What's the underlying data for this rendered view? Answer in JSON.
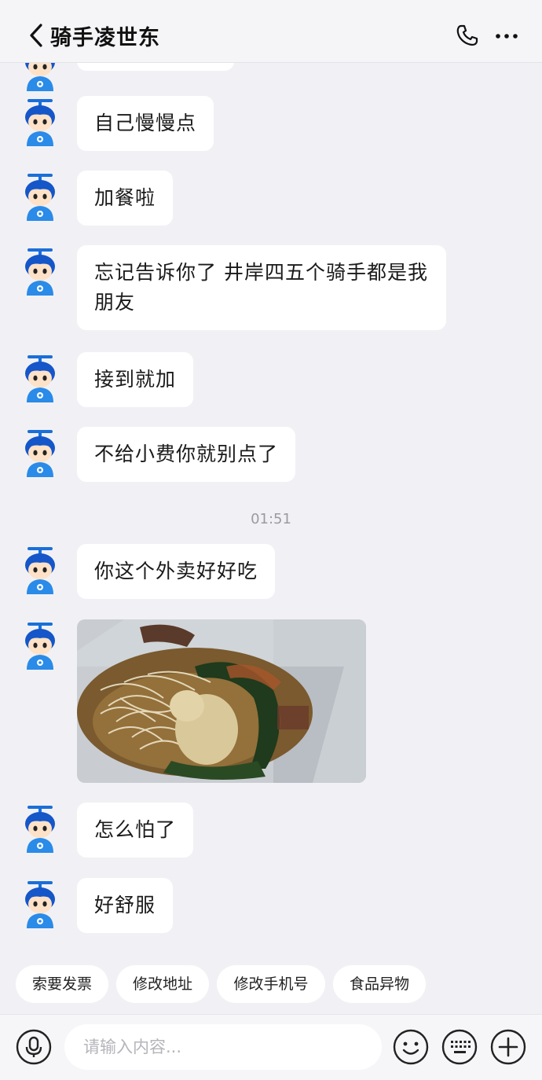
{
  "header": {
    "title": "骑手凌世东",
    "back_icon": "chevron-left-icon",
    "call_icon": "phone-icon",
    "more_icon": "more-dots-icon"
  },
  "messages": [
    {
      "text": "自己慢慢点"
    },
    {
      "text": "加餐啦"
    },
    {
      "text": "忘记告诉你了 井岸四五个骑手都是我",
      "text_line2": "朋友"
    },
    {
      "text": "接到就加"
    },
    {
      "text": "不给小费你就别点了"
    },
    {
      "text": "你这个外卖好好吃"
    },
    {
      "text": "怎么怕了"
    },
    {
      "text": "好舒服"
    }
  ],
  "timestamp": "01:51",
  "quick_replies": [
    "索要发票",
    "修改地址",
    "修改手机号",
    "食品异物"
  ],
  "input": {
    "placeholder": "请输入内容...",
    "value": ""
  },
  "icons": {
    "voice": "microphone-icon",
    "emoji": "emoji-icon",
    "keyboard": "keyboard-icon",
    "add": "plus-icon"
  },
  "colors": {
    "background": "#f1f1f5",
    "bubble": "#ffffff",
    "avatar_blue": "#2a8be8"
  }
}
